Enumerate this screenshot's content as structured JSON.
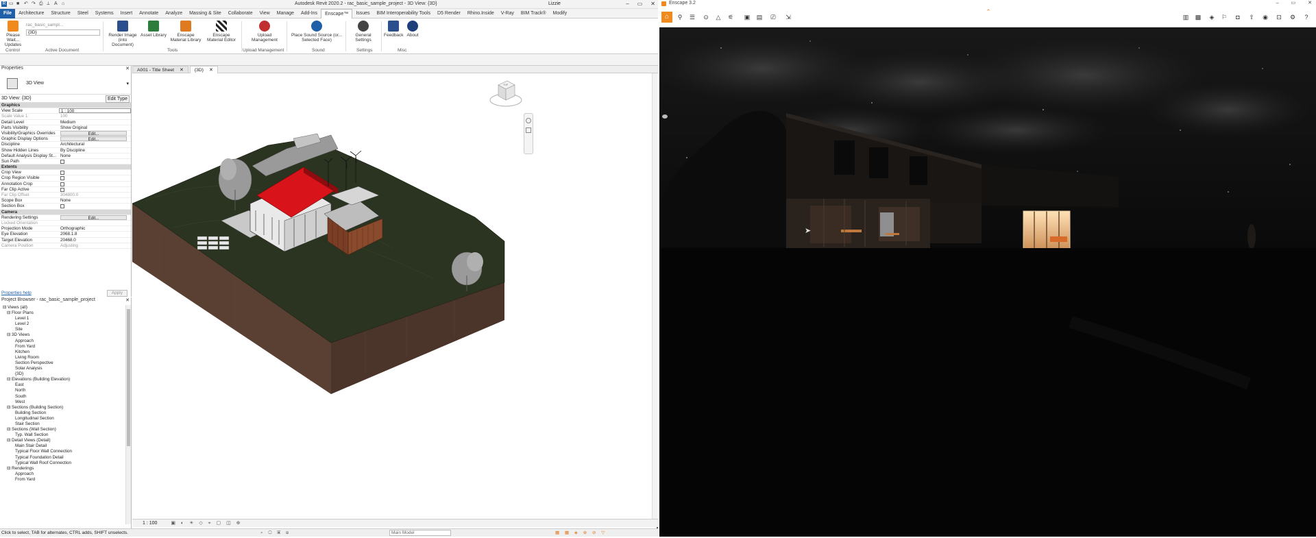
{
  "revit": {
    "title": "Autodesk Revit 2020.2 - rac_basic_sample_project - 3D View: {3D}",
    "user": "Lizzie",
    "tabs": [
      "File",
      "Architecture",
      "Structure",
      "Steel",
      "Systems",
      "Insert",
      "Annotate",
      "Analyze",
      "Massing & Site",
      "Collaborate",
      "View",
      "Manage",
      "Add-Ins",
      "Enscape™",
      "Issues",
      "BIM Interoperability Tools",
      "D5 Render",
      "Rhino.Inside",
      "V-Ray",
      "BIM Track®",
      "Modify"
    ],
    "ribbon": {
      "please_wait": "Please Wait... Updates",
      "document_name": "rac_basic_sampl...",
      "view_select": "{3D}",
      "buttons": [
        "Render Image (into Document)",
        "Asset Library",
        "Enscape Material Library",
        "Enscape Material Editor",
        "Upload Management",
        "Place Sound Source (or... Selected Face)",
        "General Settings",
        "Feedback",
        "About"
      ],
      "panels": [
        "Control",
        "Active Document",
        "Tools",
        "Upload Management",
        "Sound",
        "Settings",
        "Misc"
      ]
    },
    "properties": {
      "title": "Properties",
      "type_name": "3D View",
      "instance": "3D View: {3D}",
      "edit_type": "Edit Type",
      "rows": [
        {
          "k": "Graphics",
          "v": "",
          "kind": "group"
        },
        {
          "k": "View Scale",
          "v": "1 : 100",
          "kind": "input"
        },
        {
          "k": "Scale Value    1:",
          "v": "100",
          "kind": "dim"
        },
        {
          "k": "Detail Level",
          "v": "Medium"
        },
        {
          "k": "Parts Visibility",
          "v": "Show Original"
        },
        {
          "k": "Visibility/Graphics Overrides",
          "v": "Edit...",
          "kind": "btn"
        },
        {
          "k": "Graphic Display Options",
          "v": "Edit...",
          "kind": "btn"
        },
        {
          "k": "Discipline",
          "v": "Architectural"
        },
        {
          "k": "Show Hidden Lines",
          "v": "By Discipline"
        },
        {
          "k": "Default Analysis Display St...",
          "v": "None"
        },
        {
          "k": "Sun Path",
          "v": "",
          "kind": "chk"
        },
        {
          "k": "Extents",
          "v": "",
          "kind": "group"
        },
        {
          "k": "Crop View",
          "v": "",
          "kind": "chk"
        },
        {
          "k": "Crop Region Visible",
          "v": "",
          "kind": "chk"
        },
        {
          "k": "Annotation Crop",
          "v": "",
          "kind": "chk"
        },
        {
          "k": "Far Clip Active",
          "v": "",
          "kind": "chk"
        },
        {
          "k": "Far Clip Offset",
          "v": "304800.0",
          "kind": "dim"
        },
        {
          "k": "Scope Box",
          "v": "None"
        },
        {
          "k": "Section Box",
          "v": "",
          "kind": "chk"
        },
        {
          "k": "Camera",
          "v": "",
          "kind": "group"
        },
        {
          "k": "Rendering Settings",
          "v": "Edit...",
          "kind": "btn"
        },
        {
          "k": "Locked Orientation",
          "v": "",
          "kind": "dim"
        },
        {
          "k": "Projection Mode",
          "v": "Orthographic"
        },
        {
          "k": "Eye Elevation",
          "v": "2068.1.8"
        },
        {
          "k": "Target Elevation",
          "v": "20468.0"
        },
        {
          "k": "Camera Position",
          "v": "Adjusting",
          "kind": "dim"
        }
      ],
      "help_link": "Properties help",
      "apply": "Apply"
    },
    "browser": {
      "title": "Project Browser - rac_basic_sample_project",
      "items": [
        {
          "t": "⊟  Views (all)",
          "d": 0
        },
        {
          "t": "⊟  Floor Plans",
          "d": 1
        },
        {
          "t": "Level 1",
          "d": 3
        },
        {
          "t": "Level 2",
          "d": 3
        },
        {
          "t": "Site",
          "d": 3
        },
        {
          "t": "⊟  3D Views",
          "d": 1
        },
        {
          "t": "Approach",
          "d": 3
        },
        {
          "t": "From Yard",
          "d": 3
        },
        {
          "t": "Kitchen",
          "d": 3
        },
        {
          "t": "Living Room",
          "d": 3
        },
        {
          "t": "Section Perspective",
          "d": 3
        },
        {
          "t": "Solar Analysis",
          "d": 3
        },
        {
          "t": "{3D}",
          "d": 3
        },
        {
          "t": "⊟  Elevations (Building Elevation)",
          "d": 1
        },
        {
          "t": "East",
          "d": 3
        },
        {
          "t": "North",
          "d": 3
        },
        {
          "t": "South",
          "d": 3
        },
        {
          "t": "West",
          "d": 3
        },
        {
          "t": "⊟  Sections (Building Section)",
          "d": 1
        },
        {
          "t": "Building Section",
          "d": 3
        },
        {
          "t": "Longitudinal Section",
          "d": 3
        },
        {
          "t": "Stair Section",
          "d": 3
        },
        {
          "t": "⊟  Sections (Wall Section)",
          "d": 1
        },
        {
          "t": "Typ. Wall Section",
          "d": 3
        },
        {
          "t": "⊟  Detail Views (Detail)",
          "d": 1
        },
        {
          "t": "Main Stair Detail",
          "d": 3
        },
        {
          "t": "Typical Floor Wall Connection",
          "d": 3
        },
        {
          "t": "Typical Foundation Detail",
          "d": 3
        },
        {
          "t": "Typical Wall Roof Connection",
          "d": 3
        },
        {
          "t": "⊟  Renderings",
          "d": 1
        },
        {
          "t": "Approach",
          "d": 3
        },
        {
          "t": "From Yard",
          "d": 3
        }
      ]
    },
    "view_tabs": [
      "A001 - Title Sheet",
      "{3D}"
    ],
    "view_scale": "1 : 100",
    "status_text": "Click to select, TAB for alternates, CTRL adds, SHIFT unselects.",
    "status_model": "Main Model",
    "viewcube_labels": [
      "TOP",
      "FRONT",
      "RIGHT"
    ]
  },
  "enscape": {
    "title": "Enscape 3.2",
    "colors": {
      "accent": "#f08a1c",
      "revit_blue": "#1f5fa8",
      "roof_red": "#d8141a"
    }
  }
}
